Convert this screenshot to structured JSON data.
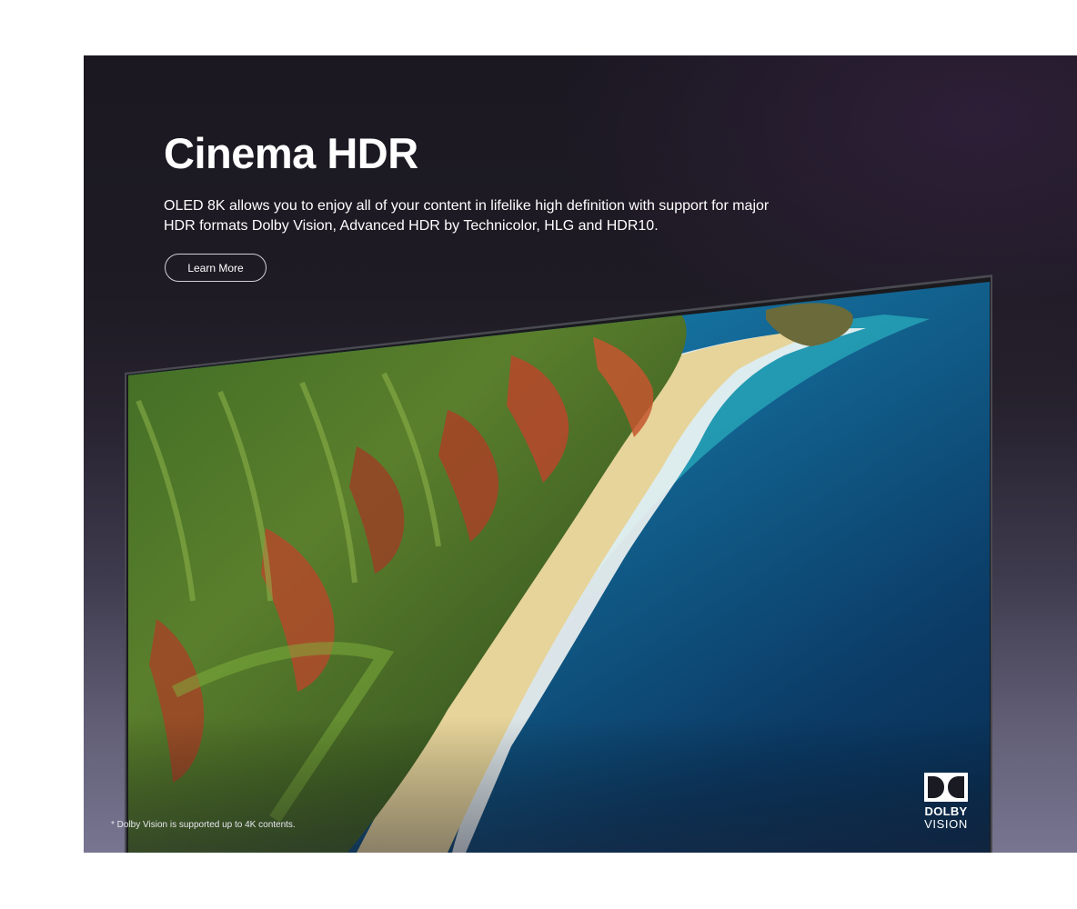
{
  "hero": {
    "title": "Cinema HDR",
    "description": "OLED 8K allows you to enjoy all of your content in lifelike high definition with support for major HDR formats Dolby Vision, Advanced HDR by Technicolor, HLG and HDR10.",
    "cta_label": "Learn More",
    "footnote": "* Dolby Vision is supported up to 4K contents."
  },
  "badge": {
    "line1": "DOLBY",
    "line2": "VISION",
    "icon": "dolby-double-d-icon"
  },
  "colors": {
    "background_top": "#1b1822",
    "background_bottom": "#777590",
    "text": "#ffffff",
    "ocean_deep": "#0b3a63",
    "ocean_shallow": "#1fa3b8",
    "cliff_green": "#4f8a2a",
    "cliff_red": "#b8472a"
  }
}
